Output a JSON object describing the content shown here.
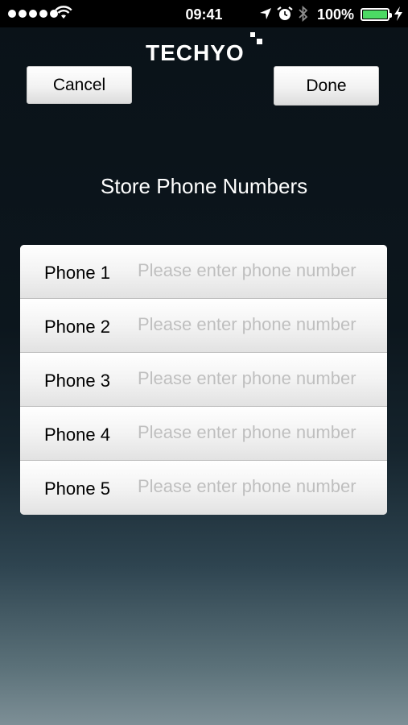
{
  "status_bar": {
    "time": "09:41",
    "battery_percent": "100%",
    "signal_dots": 5,
    "battery_level": 1.0,
    "battery_color": "#4cd964"
  },
  "logo": {
    "text": "TECHYO"
  },
  "buttons": {
    "cancel_label": "Cancel",
    "done_label": "Done"
  },
  "heading": "Store Phone Numbers",
  "phones": [
    {
      "label": "Phone 1",
      "value": "",
      "placeholder": "Please enter phone number"
    },
    {
      "label": "Phone 2",
      "value": "",
      "placeholder": "Please enter phone number"
    },
    {
      "label": "Phone 3",
      "value": "",
      "placeholder": "Please enter phone number"
    },
    {
      "label": "Phone 4",
      "value": "",
      "placeholder": "Please enter phone number"
    },
    {
      "label": "Phone 5",
      "value": "",
      "placeholder": "Please enter phone number"
    }
  ],
  "icons": [
    "signal-dots-icon",
    "wifi-icon",
    "location-arrow-icon",
    "alarm-icon",
    "bluetooth-icon",
    "battery-icon",
    "charging-bolt-icon"
  ]
}
